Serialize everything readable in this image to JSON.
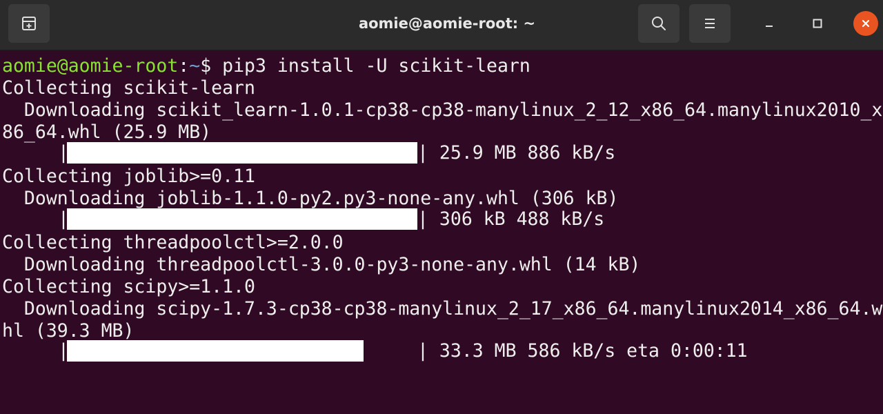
{
  "window": {
    "title": "aomie@aomie-root: ~",
    "accent_close": "#e95420",
    "background": "#300a24"
  },
  "toolbar": {
    "new_tab_icon": "new-tab-icon",
    "search_icon": "search-icon",
    "menu_icon": "hamburger-menu-icon",
    "minimize_icon": "minimize-icon",
    "maximize_icon": "maximize-icon",
    "close_icon": "close-icon"
  },
  "terminal": {
    "prompt": {
      "user_host": "aomie@aomie-root",
      "separator": ":",
      "path": "~",
      "symbol": "$ ",
      "command": "pip3 install -U scikit-learn"
    },
    "lines": [
      "Collecting scikit-learn",
      "  Downloading scikit_learn-1.0.1-cp38-cp38-manylinux_2_12_x86_64.manylinux2010_x",
      "86_64.whl (25.9 MB)",
      "Collecting joblib>=0.11",
      "  Downloading joblib-1.1.0-py2.py3-none-any.whl (306 kB)",
      "Collecting threadpoolctl>=2.0.0",
      "  Downloading threadpoolctl-3.0.0-py3-none-any.whl (14 kB)",
      "Collecting scipy>=1.1.0",
      "  Downloading scipy-1.7.3-cp38-cp38-manylinux_2_17_x86_64.manylinux2014_x86_64.w",
      "hl (39.3 MB)"
    ],
    "progress": [
      {
        "left": "|",
        "right": "| 25.9 MB 886 kB/s",
        "fraction": 1.0
      },
      {
        "left": "|",
        "right": "| 306 kB 488 kB/s",
        "fraction": 1.0
      },
      {
        "left": "|",
        "right": "| 33.3 MB 586 kB/s eta 0:00:11",
        "fraction": 0.847
      }
    ]
  }
}
